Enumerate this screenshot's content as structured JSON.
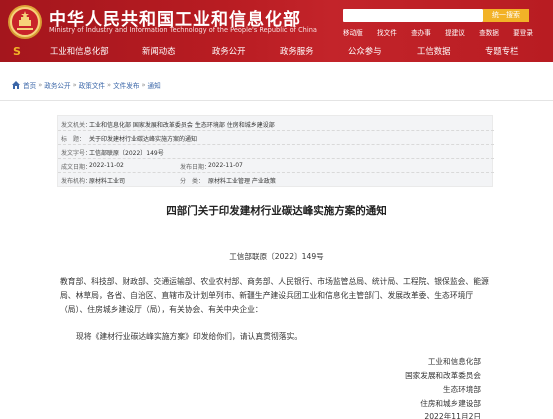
{
  "header": {
    "site_title": "中华人民共和国工业和信息化部",
    "site_title_en": "Ministry of Industry and Information Technology of the People's Republic of China",
    "search_placeholder": "",
    "search_button": "统一搜索",
    "quick_links": [
      "移动版",
      "找文件",
      "查办事",
      "提建议",
      "查数据",
      "要登录"
    ]
  },
  "nav": {
    "items": [
      "工业和信息化部",
      "新闻动态",
      "政务公开",
      "政务服务",
      "公众参与",
      "工信数据",
      "专题专栏"
    ]
  },
  "breadcrumb": [
    "首页",
    "政务公开",
    "政策文件",
    "文件发布",
    "通知"
  ],
  "info": {
    "issuer_label": "发文机关：",
    "issuer_value": "工业和信息化部 国家发展和改革委员会 生态环境部 住房和城乡建设部",
    "title_label": "标　题：",
    "title_value": "关于印发建材行业碳达峰实施方案的通知",
    "docno_label": "发文字号：",
    "docno_value": "工信部联原〔2022〕149号",
    "date_label": "成文日期：",
    "date_value": "2022-11-02",
    "pubdate_label": "发布日期：",
    "pubdate_value": "2022-11-07",
    "org_label": "发布机构：",
    "org_value": "原材料工业司",
    "cat_label": "分　类：",
    "cat_value": "原材料工业管理 产业政策"
  },
  "document": {
    "title": "四部门关于印发建材行业碳达峰实施方案的通知",
    "doc_number": "工信部联原〔2022〕149号",
    "recipients": "教育部、科技部、财政部、交通运输部、农业农村部、商务部、人民银行、市场监管总局、统计局、工程院、银保监会、能源局、林草局，各省、自治区、直辖市及计划单列市、新疆生产建设兵团工业和信息化主管部门、发展改革委、生态环境厅（局）、住房城乡建设厅（局），有关协会、有关中央企业：",
    "body": "现将《建材行业碳达峰实施方案》印发给你们，请认真贯彻落实。",
    "signatures": [
      "工业和信息化部",
      "国家发展和改革委员会",
      "生态环境部",
      "住房和城乡建设部",
      "2022年11月2日"
    ]
  },
  "colors": {
    "header_red": "#b81c22",
    "search_button": "#f2b227",
    "breadcrumb_link": "#3a66a8"
  },
  "icons": {
    "home": "home-icon",
    "emblem": "national-emblem"
  }
}
